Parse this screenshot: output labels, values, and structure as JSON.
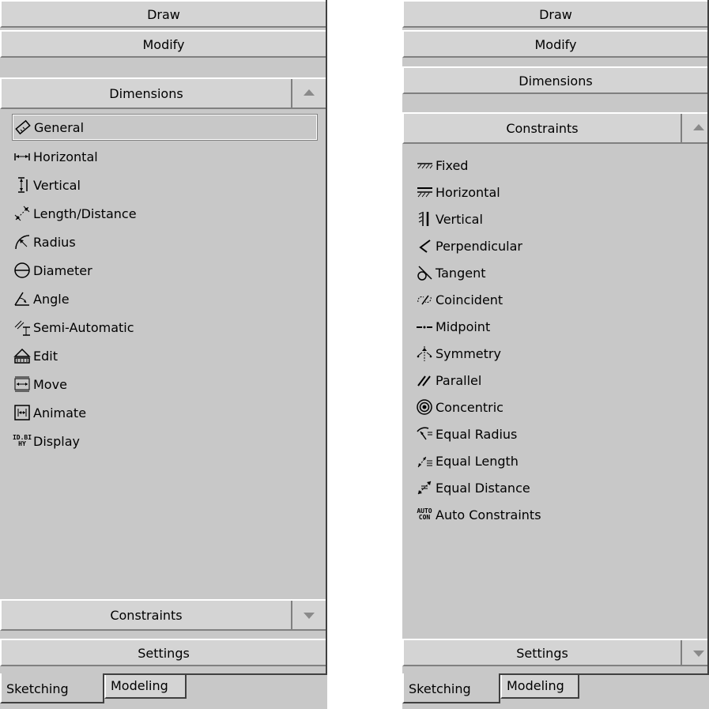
{
  "left_panel": {
    "sections": {
      "draw": "Draw",
      "modify": "Modify",
      "dimensions": "Dimensions",
      "constraints": "Constraints",
      "settings": "Settings"
    },
    "items": [
      {
        "label": "General",
        "icon": "general-dimension-icon"
      },
      {
        "label": "Horizontal",
        "icon": "horizontal-dimension-icon"
      },
      {
        "label": "Vertical",
        "icon": "vertical-dimension-icon"
      },
      {
        "label": "Length/Distance",
        "icon": "length-distance-icon"
      },
      {
        "label": "Radius",
        "icon": "radius-icon"
      },
      {
        "label": "Diameter",
        "icon": "diameter-icon"
      },
      {
        "label": "Angle",
        "icon": "angle-icon"
      },
      {
        "label": "Semi-Automatic",
        "icon": "semi-automatic-icon"
      },
      {
        "label": "Edit",
        "icon": "edit-dimension-icon"
      },
      {
        "label": "Move",
        "icon": "move-dimension-icon"
      },
      {
        "label": "Animate",
        "icon": "animate-icon"
      },
      {
        "label": "Display",
        "icon": "display-icon",
        "icon_text": "ID.BI\nHY"
      }
    ],
    "tabs": [
      "Sketching",
      "Modeling"
    ]
  },
  "right_panel": {
    "sections": {
      "draw": "Draw",
      "modify": "Modify",
      "dimensions": "Dimensions",
      "constraints": "Constraints",
      "settings": "Settings"
    },
    "items": [
      {
        "label": "Fixed",
        "icon": "fixed-icon"
      },
      {
        "label": "Horizontal",
        "icon": "horizontal-constraint-icon"
      },
      {
        "label": "Vertical",
        "icon": "vertical-constraint-icon"
      },
      {
        "label": "Perpendicular",
        "icon": "perpendicular-icon"
      },
      {
        "label": "Tangent",
        "icon": "tangent-icon"
      },
      {
        "label": "Coincident",
        "icon": "coincident-icon"
      },
      {
        "label": "Midpoint",
        "icon": "midpoint-icon"
      },
      {
        "label": "Symmetry",
        "icon": "symmetry-icon"
      },
      {
        "label": "Parallel",
        "icon": "parallel-icon"
      },
      {
        "label": "Concentric",
        "icon": "concentric-icon"
      },
      {
        "label": "Equal Radius",
        "icon": "equal-radius-icon"
      },
      {
        "label": "Equal Length",
        "icon": "equal-length-icon"
      },
      {
        "label": "Equal Distance",
        "icon": "equal-distance-icon"
      },
      {
        "label": "Auto Constraints",
        "icon": "auto-constraints-icon",
        "icon_text": "AUTO\nCON"
      }
    ],
    "tabs": [
      "Sketching",
      "Modeling"
    ]
  }
}
